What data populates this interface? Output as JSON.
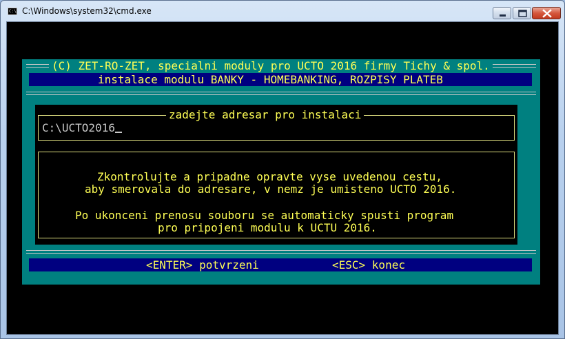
{
  "window": {
    "title": "C:\\Windows\\system32\\cmd.exe",
    "icon": "cmd-icon",
    "icon_text": "C:\\",
    "controls": [
      "minimize",
      "maximize",
      "close"
    ]
  },
  "installer": {
    "copyright": "(C) ZET-RO-ZET, specialni moduly pro UCTO 2016 firmy Tichy & spol.",
    "subtitle": "instalace modulu BANKY - HOMEBANKING, ROZPISY PLATEB",
    "path_prompt": "zadejte adresar pro instalaci",
    "path_value": "C:\\UCTO2016",
    "info_lines": [
      "Zkontrolujte a pripadne opravte vyse uvedenou cestu,",
      "aby smerovala do adresare, v nemz je umisteno UCTO 2016.",
      "",
      "Po ukonceni prenosu souboru se automaticky spusti program",
      "pro pripojeni modulu k UCTU 2016."
    ],
    "enter_label": "<ENTER> potvrzeni",
    "esc_label": "<ESC> konec"
  },
  "colors": {
    "teal": "#008080",
    "navy": "#000080",
    "yellow": "#ffff55",
    "console_bg": "#000000"
  }
}
